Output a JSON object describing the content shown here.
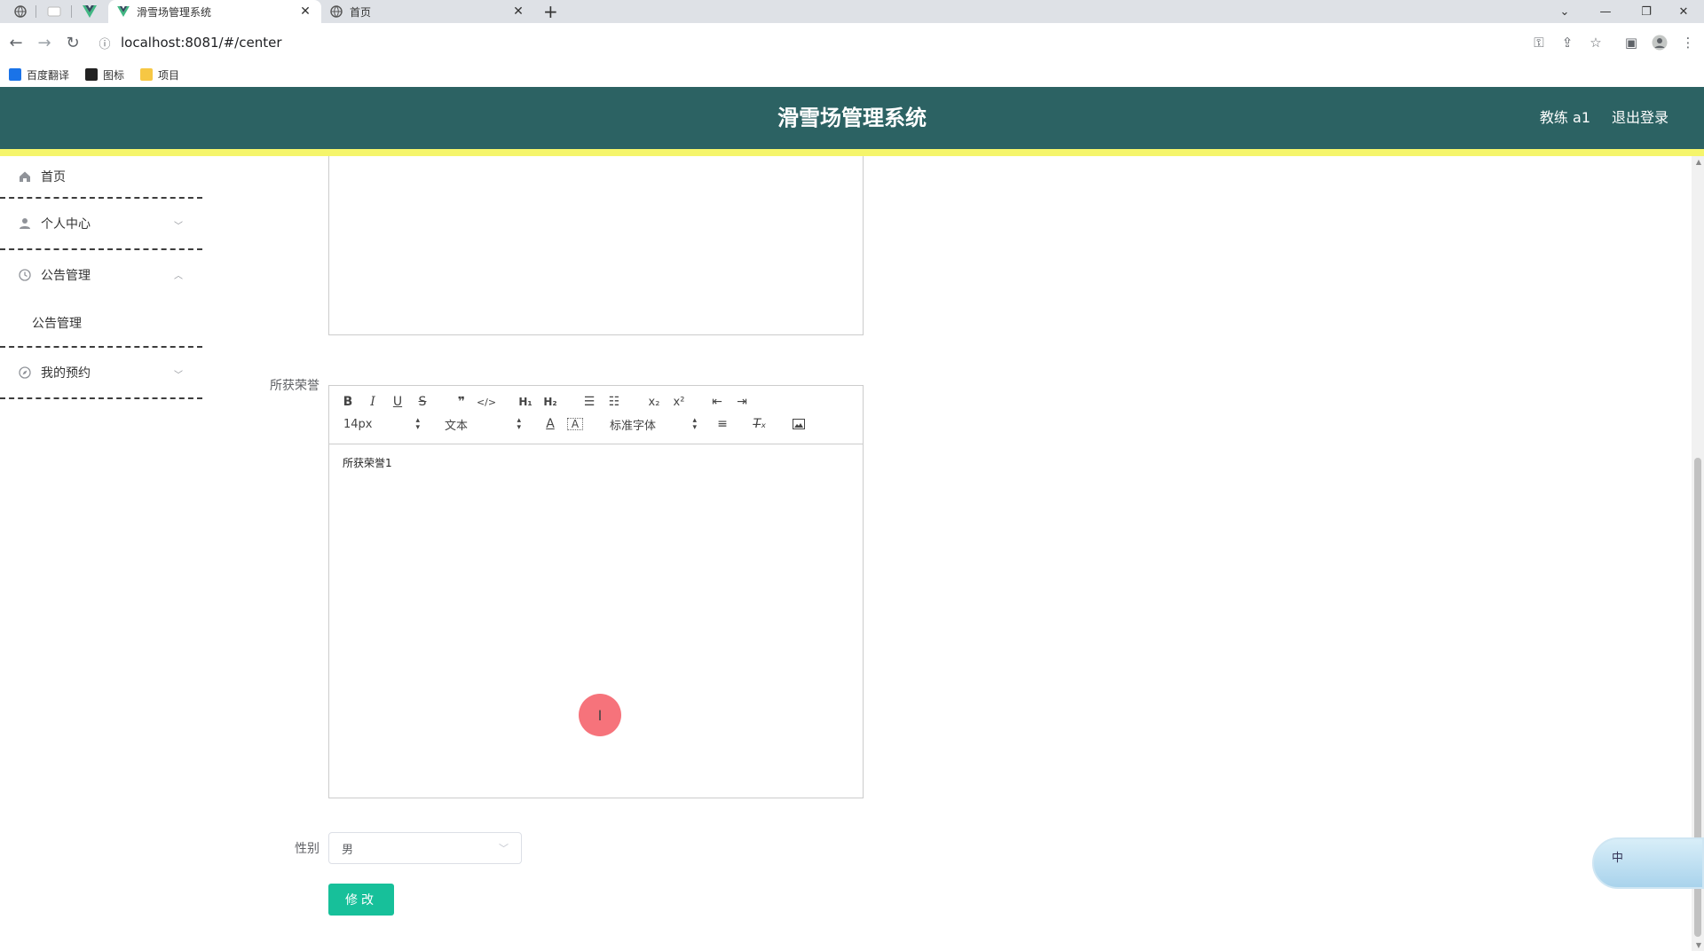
{
  "browser": {
    "tabs": [
      {
        "title": "滑雪场管理系统",
        "active": true
      },
      {
        "title": "首页",
        "active": false
      }
    ],
    "url": "localhost:8081/#/center",
    "bookmarks": [
      {
        "label": "百度翻译",
        "icon": "translate-icon",
        "color": "#1a73e8"
      },
      {
        "label": "图标",
        "icon": "image-icon",
        "color": "#222222"
      },
      {
        "label": "项目",
        "icon": "folder-icon",
        "color": "#f6c744"
      }
    ]
  },
  "header": {
    "title": "滑雪场管理系统",
    "user": "教练 a1",
    "logout": "退出登录",
    "bg_color": "#2c6263",
    "accent_bar_color": "#f5f56b"
  },
  "sidebar": {
    "items": [
      {
        "label": "首页",
        "icon": "home-icon"
      },
      {
        "label": "个人中心",
        "icon": "user-icon",
        "expandable": true
      },
      {
        "label": "公告管理",
        "icon": "clock-icon",
        "expandable": true,
        "expanded": true,
        "children": [
          {
            "label": "公告管理"
          }
        ]
      },
      {
        "label": "我的预约",
        "icon": "compass-icon",
        "expandable": true
      }
    ]
  },
  "form": {
    "honors_label": "所获荣誉",
    "honors_content": "所获荣誉1",
    "toolbar": {
      "font_size": "14px",
      "header_select": "文本",
      "font_family": "标准字体"
    },
    "gender_label": "性别",
    "gender_value": "男",
    "submit_label": "修改",
    "submit_color": "#17c09a"
  },
  "ime_widget": {
    "label": "中"
  }
}
